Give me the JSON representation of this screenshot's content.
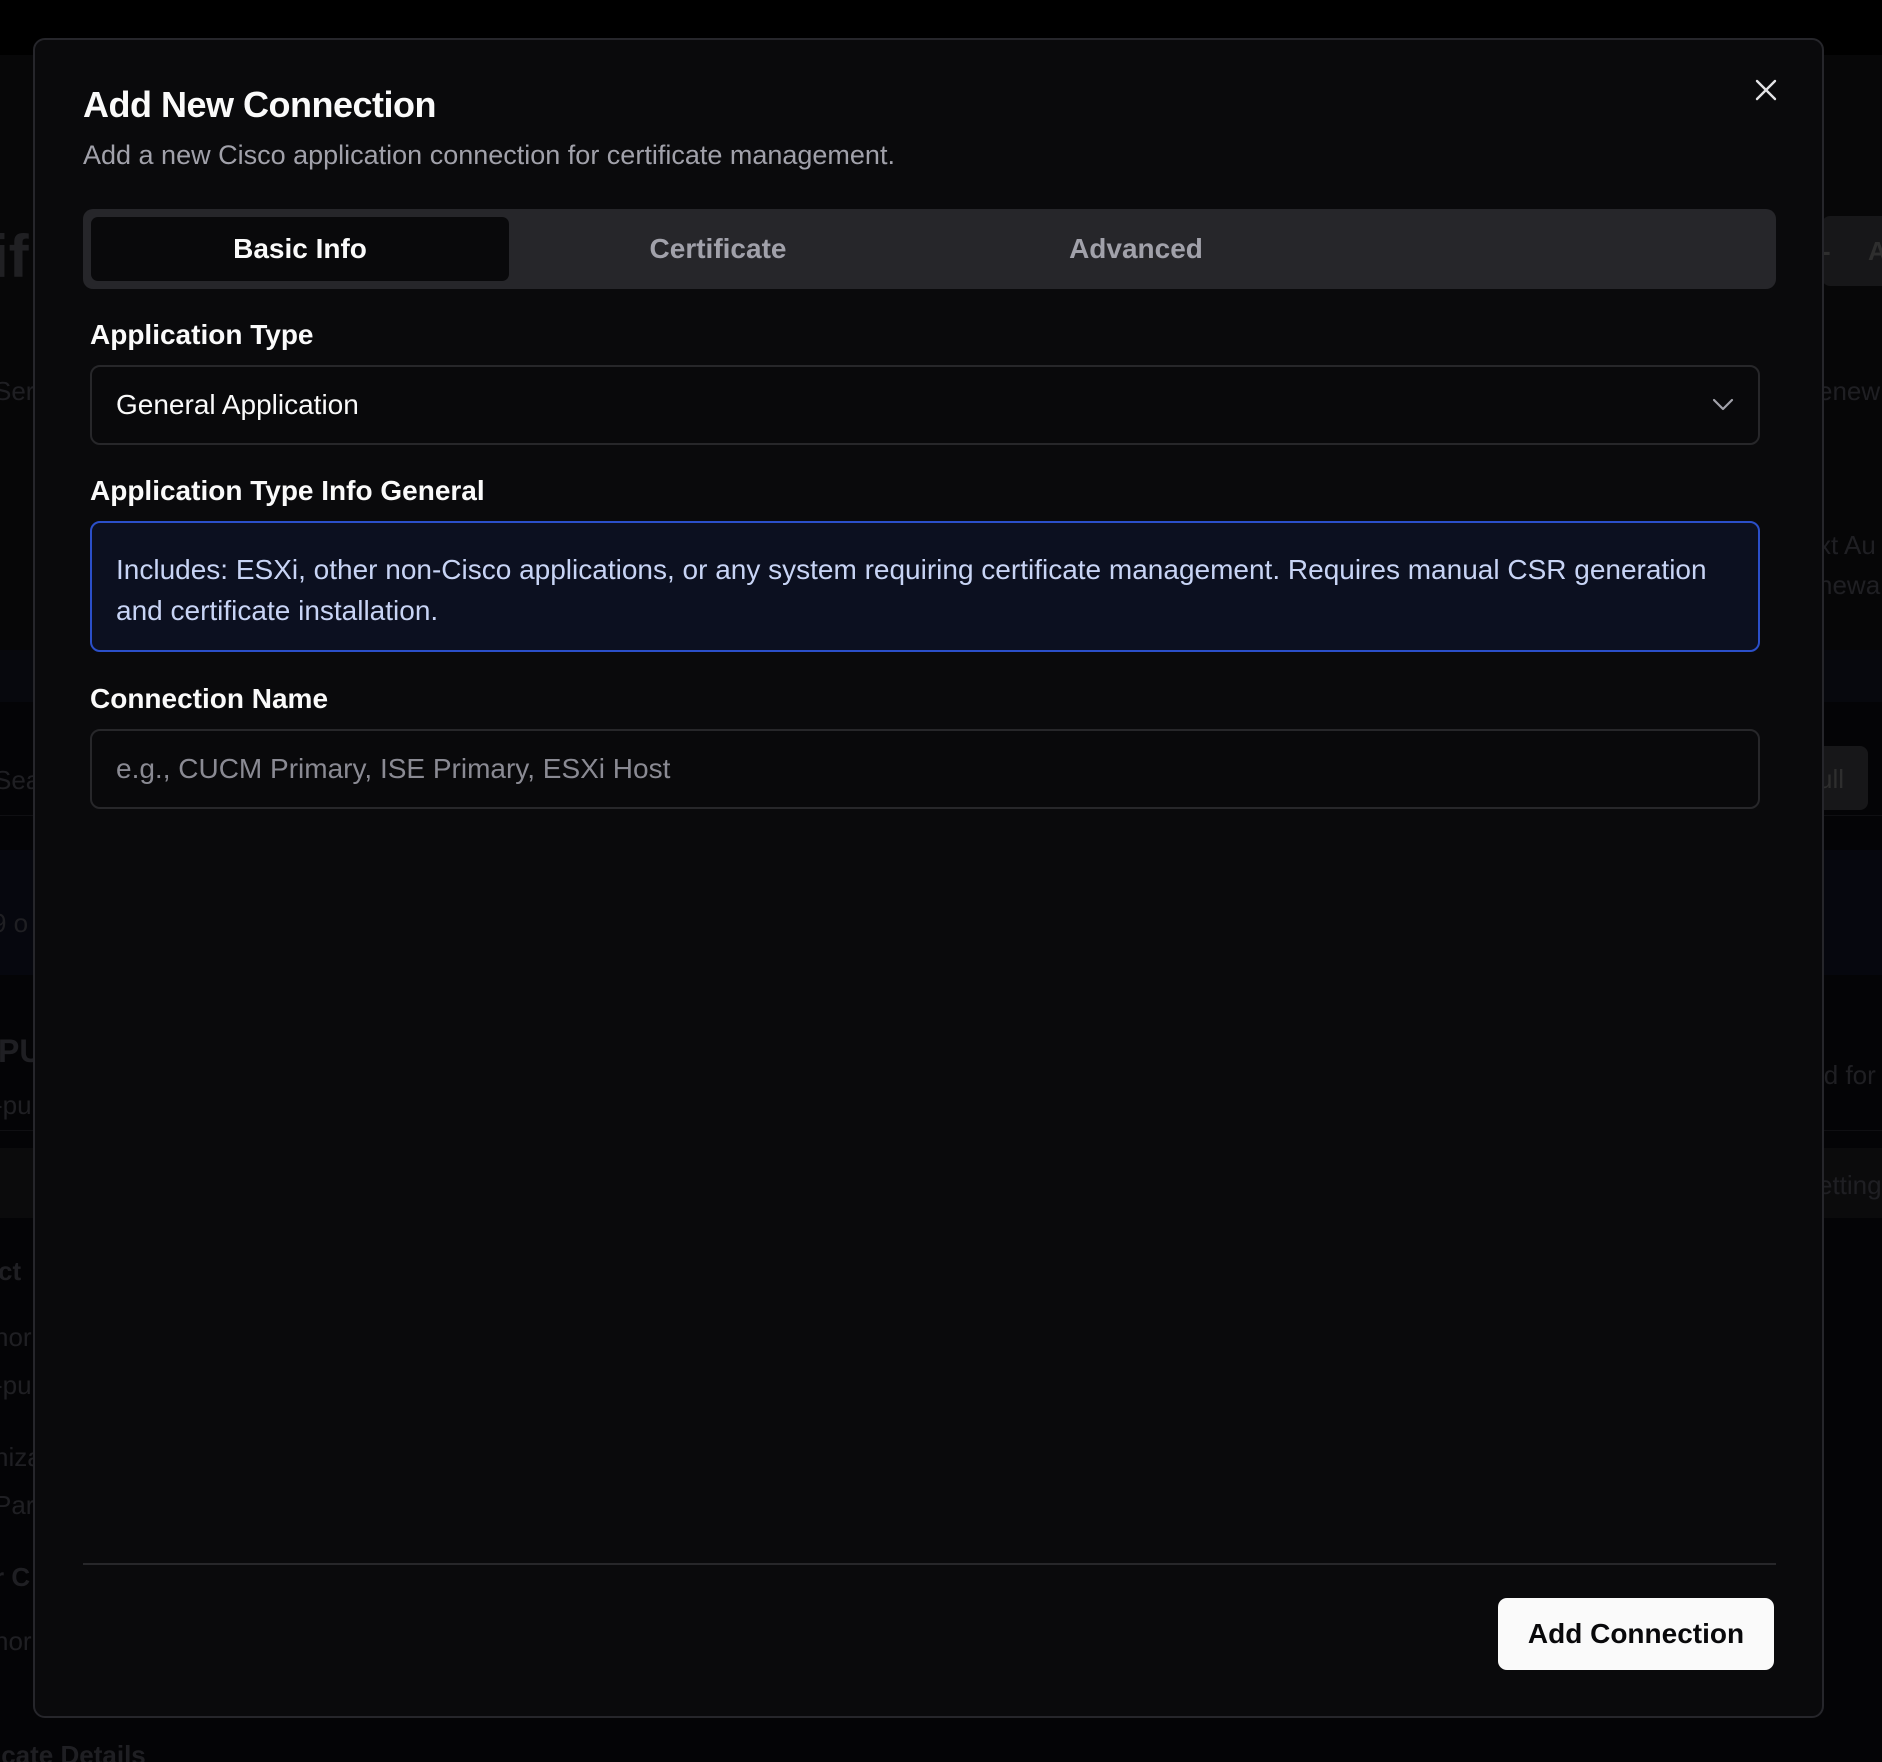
{
  "background": {
    "fragments": [
      "if",
      "Ser",
      "enew",
      "xt Au",
      "newa",
      "Sea",
      "ull",
      "9 o",
      "PU",
      "-pu",
      "id for",
      "etting",
      "ct",
      "nor",
      "-pu",
      "niza",
      "Par",
      "r C",
      "nor",
      "icate Details",
      "-",
      "A"
    ]
  },
  "dialog": {
    "title": "Add New Connection",
    "description": "Add a new Cisco application connection for certificate management.",
    "close_icon": "close-icon",
    "tabs": [
      {
        "label": "Basic Info",
        "active": true
      },
      {
        "label": "Certificate",
        "active": false
      },
      {
        "label": "Advanced",
        "active": false
      }
    ],
    "application_type": {
      "label": "Application Type",
      "value": "General Application",
      "icon": "chevron-down-icon"
    },
    "application_type_info": {
      "label": "Application Type Info General",
      "text": "Includes: ESXi, other non-Cisco applications, or any system requiring certificate management. Requires manual CSR generation and certificate installation."
    },
    "connection_name": {
      "label": "Connection Name",
      "value": "",
      "placeholder": "e.g., CUCM Primary, ISE Primary, ESXi Host"
    },
    "submit_label": "Add Connection"
  },
  "colors": {
    "background": "#0a0a0c",
    "info_border": "#2b4fc9",
    "info_bg": "#0c1020",
    "primary_button": "#fafafa"
  }
}
